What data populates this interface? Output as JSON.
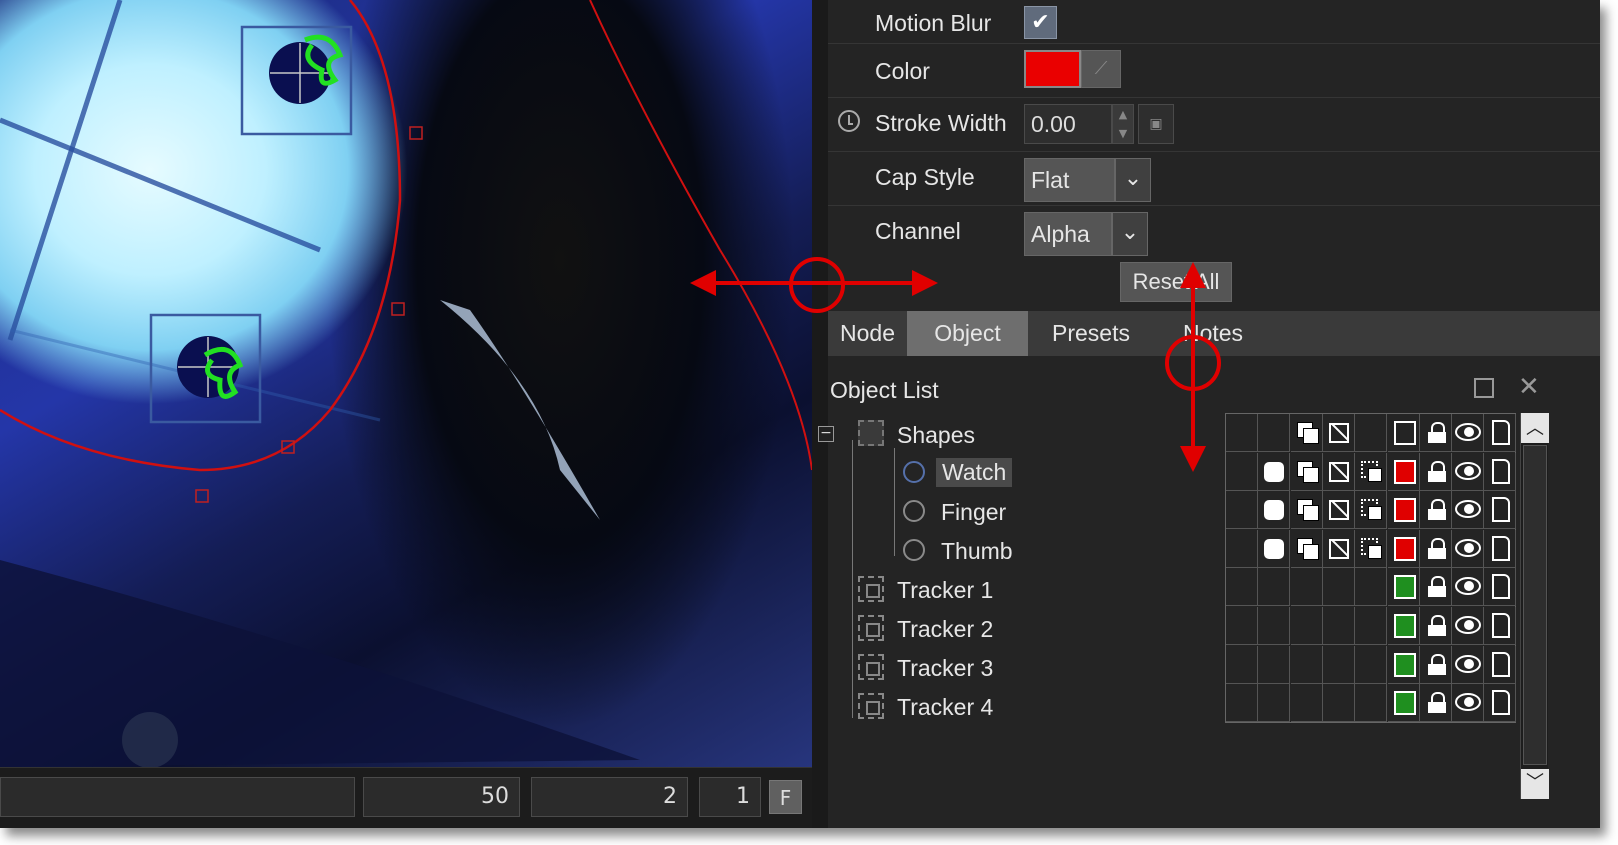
{
  "viewer": {
    "fields": [
      "",
      "50",
      "2",
      "1"
    ],
    "f_button": "F"
  },
  "properties": {
    "motion_blur_label": "Motion Blur",
    "motion_blur_checked": true,
    "color_label": "Color",
    "color_value": "#ea0000",
    "stroke_width_label": "Stroke Width",
    "stroke_width_value": "0.00",
    "cap_style_label": "Cap Style",
    "cap_style_value": "Flat",
    "channel_label": "Channel",
    "channel_value": "Alpha",
    "reset_all_label": "Reset All"
  },
  "tabs": [
    {
      "label": "Node",
      "active": false
    },
    {
      "label": "Object",
      "active": true
    },
    {
      "label": "Presets",
      "active": false
    },
    {
      "label": "Notes",
      "active": false
    }
  ],
  "object_list": {
    "title": "Object List",
    "group": {
      "label": "Shapes",
      "collapsed": false
    },
    "shapes": [
      {
        "label": "Watch",
        "selected": true
      },
      {
        "label": "Finger",
        "selected": false
      },
      {
        "label": "Thumb",
        "selected": false
      }
    ],
    "trackers": [
      {
        "label": "Tracker 1"
      },
      {
        "label": "Tracker 2"
      },
      {
        "label": "Tracker 3"
      },
      {
        "label": "Tracker 4"
      }
    ],
    "shape_color": "#e00000",
    "tracker_color": "#1f8f1f"
  },
  "icons": {
    "shape_column_icons": [
      "round-icon",
      "duplicate-icon",
      "no-entry-icon",
      "duplicate-outline-icon",
      "color-icon",
      "lock-icon",
      "eye-icon",
      "document-icon"
    ]
  }
}
